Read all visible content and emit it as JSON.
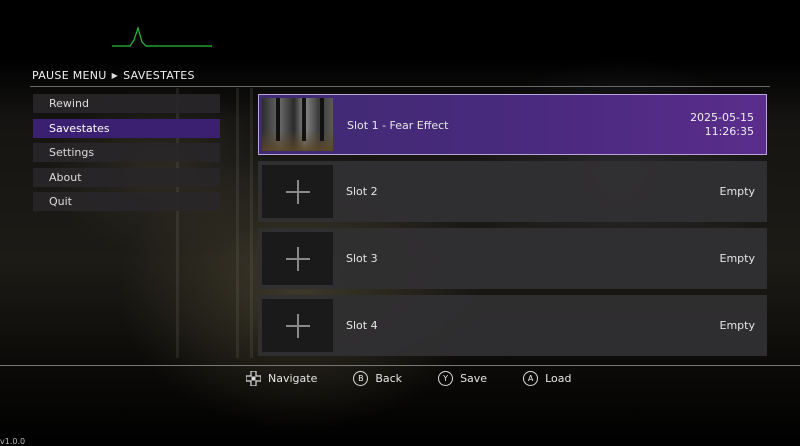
{
  "breadcrumb": {
    "parent": "PAUSE MENU",
    "current": "SAVESTATES"
  },
  "menu": {
    "items": [
      {
        "label": "Rewind",
        "active": false
      },
      {
        "label": "Savestates",
        "active": true
      },
      {
        "label": "Settings",
        "active": false
      },
      {
        "label": "About",
        "active": false
      },
      {
        "label": "Quit",
        "active": false
      }
    ]
  },
  "slots": [
    {
      "name": "Slot 1 - Fear Effect",
      "date": "2025-05-15",
      "time": "11:26:35",
      "status": "",
      "has_save": true,
      "selected": true
    },
    {
      "name": "Slot 2",
      "status": "Empty",
      "has_save": false,
      "selected": false
    },
    {
      "name": "Slot 3",
      "status": "Empty",
      "has_save": false,
      "selected": false
    },
    {
      "name": "Slot 4",
      "status": "Empty",
      "has_save": false,
      "selected": false
    }
  ],
  "hints": {
    "navigate": {
      "icon": "dpad-icon",
      "label": "Navigate"
    },
    "back": {
      "button": "B",
      "label": "Back"
    },
    "save": {
      "button": "Y",
      "label": "Save"
    },
    "load": {
      "button": "A",
      "label": "Load"
    }
  },
  "version": "v1.0.0",
  "colors": {
    "accent": "#3b1f70",
    "signal": "#1fbf3a"
  }
}
